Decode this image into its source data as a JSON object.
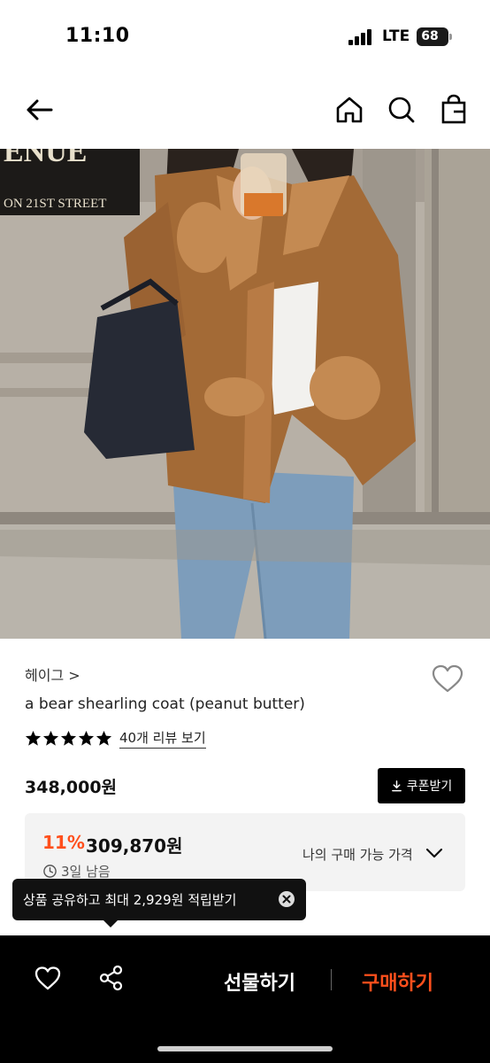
{
  "status_bar": {
    "time": "11:10",
    "network": "LTE",
    "battery": "68"
  },
  "nav": {
    "back_icon": "arrow-left-icon",
    "home_icon": "home-icon",
    "search_icon": "search-icon",
    "bag_icon": "shopping-bag-icon"
  },
  "hero": {
    "sign_line1": "ENUE",
    "sign_line2": "ON 21ST STREET"
  },
  "product": {
    "brand": "헤이그 >",
    "name": "a bear shearling coat (peanut butter)",
    "rating_stars": 5,
    "review_link": "40개 리뷰 보기",
    "price": "348,000원",
    "coupon_button": "쿠폰받기"
  },
  "my_price": {
    "discount": "11%",
    "sale_price": "309,870원",
    "time_left": "3일 남음",
    "label": "나의 구매 가능 가격"
  },
  "tooltip": {
    "text": "상품 공유하고 최대 2,929원 적립받기"
  },
  "bottom_bar": {
    "gift_label": "선물하기",
    "buy_label": "구매하기"
  },
  "colors": {
    "accent": "#ff4f1c",
    "bottom_bar_bg": "#000000",
    "info_box_bg": "#f3f3f3"
  }
}
